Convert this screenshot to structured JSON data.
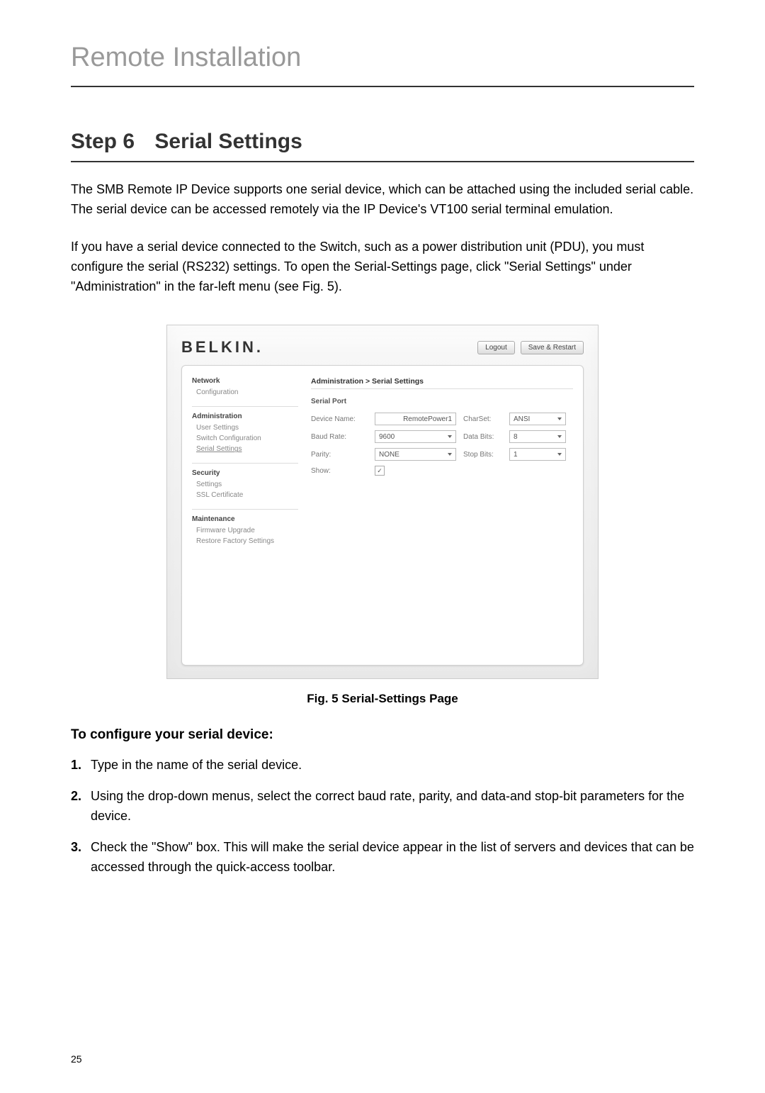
{
  "page_title": "Remote Installation",
  "step": {
    "number": "Step 6",
    "title": "Serial Settings"
  },
  "paragraphs": {
    "p1": "The SMB Remote IP Device supports one serial device, which can be attached using the included serial cable. The serial device can be accessed remotely via the IP Device's VT100 serial terminal emulation.",
    "p2": "If you have a serial device connected to the Switch, such as a power distribution unit (PDU), you must configure the serial (RS232) settings. To open the Serial-Settings page, click \"Serial Settings\" under \"Administration\" in the far-left menu (see Fig. 5)."
  },
  "screenshot": {
    "logo": "BELKIN.",
    "buttons": {
      "logout": "Logout",
      "save_restart": "Save & Restart"
    },
    "sidebar": {
      "network": {
        "head": "Network",
        "items": [
          "Configuration"
        ]
      },
      "administration": {
        "head": "Administration",
        "items": [
          "User Settings",
          "Switch Configuration",
          "Serial Settings"
        ]
      },
      "security": {
        "head": "Security",
        "items": [
          "Settings",
          "SSL Certificate"
        ]
      },
      "maintenance": {
        "head": "Maintenance",
        "items": [
          "Firmware Upgrade",
          "Restore Factory Settings"
        ]
      }
    },
    "content": {
      "breadcrumb": "Administration > Serial Settings",
      "section": "Serial Port",
      "fields": {
        "device_name": {
          "label": "Device Name:",
          "value": "RemotePower1"
        },
        "baud_rate": {
          "label": "Baud Rate:",
          "value": "9600"
        },
        "parity": {
          "label": "Parity:",
          "value": "NONE"
        },
        "show": {
          "label": "Show:",
          "checked": true
        },
        "charset": {
          "label": "CharSet:",
          "value": "ANSI"
        },
        "data_bits": {
          "label": "Data Bits:",
          "value": "8"
        },
        "stop_bits": {
          "label": "Stop Bits:",
          "value": "1"
        }
      }
    }
  },
  "figure_caption": "Fig. 5 Serial-Settings Page",
  "subheading": "To configure your serial device:",
  "steps": {
    "s1": {
      "num": "1.",
      "text": "Type in the name of the serial device."
    },
    "s2": {
      "num": "2.",
      "text": "Using the drop-down menus, select the correct baud rate, parity, and data-and stop-bit parameters for the device."
    },
    "s3": {
      "num": "3.",
      "text": "Check the \"Show\" box. This will make the serial device appear in the list of servers and devices that can be accessed through the quick-access toolbar."
    }
  },
  "page_number": "25"
}
